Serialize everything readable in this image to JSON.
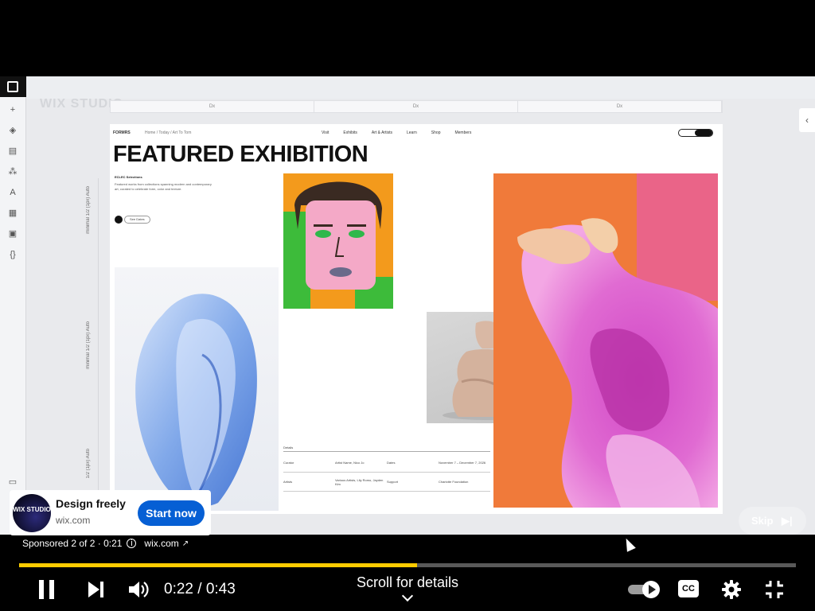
{
  "page": {
    "title": "YouTube ad player"
  },
  "video_content": {
    "editor_brand": "WIX STUDIO",
    "ruler_labels": [
      "Dx",
      "Dx",
      "Dx"
    ],
    "site": {
      "brand": "FORMRS",
      "crumbs": "Home / Today / Art To Tom",
      "nav_links": [
        "Visit",
        "Exhibits",
        "Art & Artists",
        "Learn",
        "Shop",
        "Members"
      ],
      "title": "FEATURED EXHIBITION",
      "intro_title": "ECLEC Selections",
      "intro_text": "Featured works from collections spanning modern and contemporary art, curated to celebrate form, color and texture.",
      "see_button": "See Dates",
      "info_title": "Details",
      "info_rows": [
        [
          "Curator",
          "Artist Name, Nico Jo",
          "Dates",
          "November 7 – December 7, 2026"
        ],
        [
          "Artists",
          "Various Artists, Lily Romo, Jayden Kim",
          "Support",
          "Charlotte Foundation"
        ]
      ]
    },
    "ruler_side_labels": [
      "minimal 1/2 (1px) Auto",
      "minimal 1/2 (1px) Auto",
      "1/2 (1px) Auto"
    ]
  },
  "ad": {
    "logo_text": "WIX STUDIO",
    "title": "Design freely",
    "domain": "wix.com",
    "cta": "Start now",
    "skip_label": "Skip",
    "sponsored": "Sponsored 2 of 2 · 0:21",
    "sponsor_domain": "wix.com"
  },
  "player": {
    "progress_fraction": 0.512,
    "current_time": "0:22",
    "duration": "0:43",
    "time_display": "0:22 / 0:43",
    "scroll_hint": "Scroll for details",
    "colors": {
      "progress": "#ffcc00",
      "cta": "#065fd4"
    },
    "icons": [
      "pause-icon",
      "next-icon",
      "volume-icon",
      "autoplay-toggle",
      "captions-icon",
      "settings-icon",
      "exit-fullscreen-icon"
    ]
  }
}
